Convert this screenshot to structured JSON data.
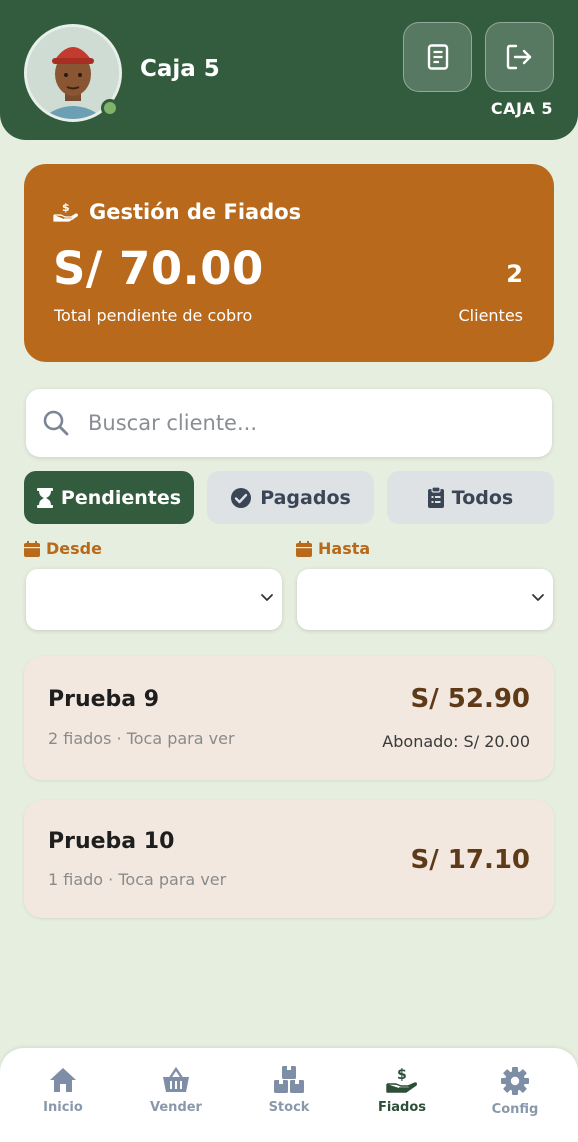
{
  "header": {
    "title": "Caja 5",
    "caja_label": "CAJA 5",
    "status": "online"
  },
  "summary": {
    "title": "Gestión de Fiados",
    "amount": "S/ 70.00",
    "amount_caption": "Total pendiente de cobro",
    "clients_count": "2",
    "clients_caption": "Clientes"
  },
  "search": {
    "placeholder": "Buscar cliente...",
    "value": ""
  },
  "tabs": [
    {
      "label": "Pendientes",
      "icon": "hourglass-icon",
      "active": true
    },
    {
      "label": "Pagados",
      "icon": "check-circle-icon",
      "active": false
    },
    {
      "label": "Todos",
      "icon": "clipboard-icon",
      "active": false
    }
  ],
  "filters": {
    "desde_label": "Desde",
    "hasta_label": "Hasta",
    "desde_value": "",
    "hasta_value": ""
  },
  "clients": [
    {
      "name": "Prueba 9",
      "subtitle": "2 fiados · Toca para ver",
      "amount": "S/ 52.90",
      "paid": "Abonado: S/ 20.00"
    },
    {
      "name": "Prueba 10",
      "subtitle": "1 fiado · Toca para ver",
      "amount": "S/ 17.10"
    }
  ],
  "nav": [
    {
      "label": "Inicio",
      "icon": "home-icon",
      "active": false
    },
    {
      "label": "Vender",
      "icon": "basket-icon",
      "active": false
    },
    {
      "label": "Stock",
      "icon": "boxes-icon",
      "active": false
    },
    {
      "label": "Fiados",
      "icon": "hand-dollar-icon",
      "active": true
    },
    {
      "label": "Config",
      "icon": "gear-icon",
      "active": false
    }
  ],
  "colors": {
    "primary": "#335c3f",
    "accent": "#b8691b",
    "background": "#e6eedf",
    "card": "#f2e8df"
  }
}
